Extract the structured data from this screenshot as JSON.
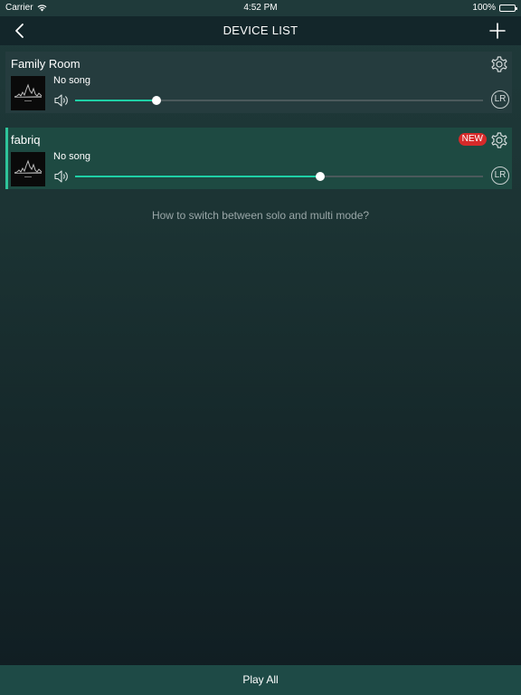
{
  "status_bar": {
    "carrier": "Carrier",
    "time": "4:52 PM",
    "battery": "100%"
  },
  "nav": {
    "title": "DEVICE LIST",
    "back_icon": "chevron-left-icon",
    "add_icon": "plus-icon"
  },
  "devices": [
    {
      "name": "Family Room",
      "song": "No song",
      "volume": 0.2,
      "channel_label": "LR",
      "is_new": false,
      "selected": false
    },
    {
      "name": "fabriq",
      "song": "No song",
      "volume": 0.6,
      "channel_label": "LR",
      "is_new": true,
      "new_label": "NEW",
      "selected": true
    }
  ],
  "help_text": "How to switch between solo and multi mode?",
  "bottom_bar": {
    "play_all_label": "Play All"
  },
  "colors": {
    "accent": "#1fd0a6",
    "new_badge": "#d62a2a",
    "selected_card": "#1e4a42"
  }
}
